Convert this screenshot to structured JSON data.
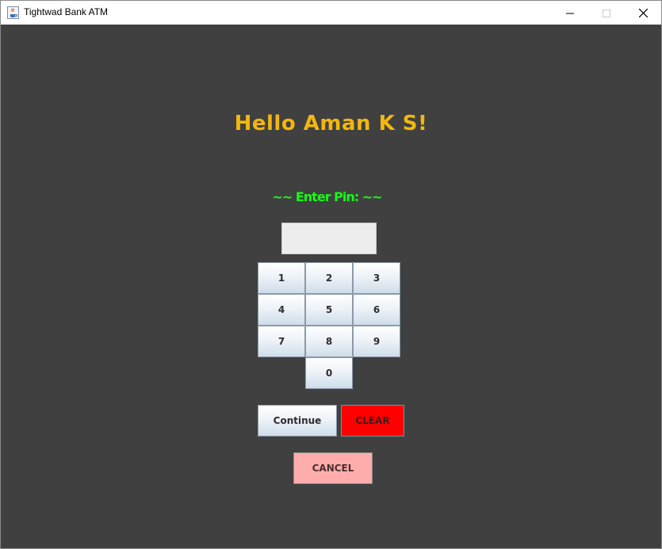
{
  "window": {
    "title": "Tightwad Bank ATM",
    "minimize_icon": "minimize-icon",
    "maximize_icon": "maximize-icon",
    "close_icon": "close-icon",
    "app_icon": "java-cup-icon"
  },
  "main": {
    "greeting": "Hello Aman K S!",
    "prompt": "~~ Enter Pin: ~~",
    "pin_value": "",
    "keypad": [
      "1",
      "2",
      "3",
      "4",
      "5",
      "6",
      "7",
      "8",
      "9",
      "0"
    ],
    "continue_label": "Continue",
    "clear_label": "CLEAR",
    "cancel_label": "CANCEL"
  },
  "colors": {
    "background": "#404040",
    "greeting": "#f2b70f",
    "prompt": "#14ff14",
    "clear_button": "#ff0000",
    "cancel_button": "#ffacac"
  }
}
